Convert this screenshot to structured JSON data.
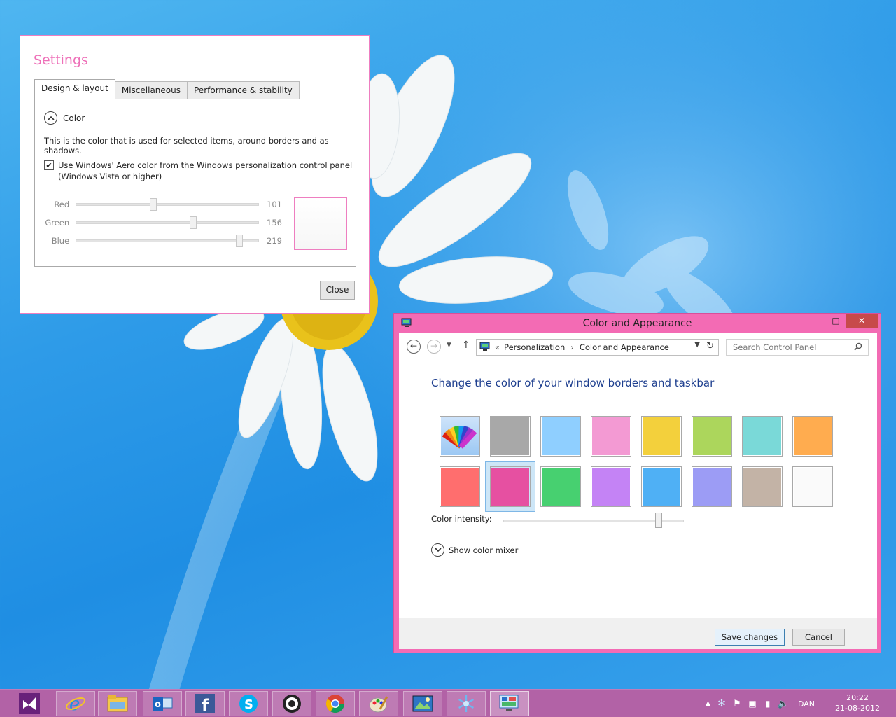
{
  "settings": {
    "title": "Settings",
    "tabs": [
      "Design & layout",
      "Miscellaneous",
      "Performance & stability"
    ],
    "section_title": "Color",
    "description": "This is the color that is used for selected items, around borders and as shadows.",
    "checkbox_label_line1": "Use Windows' Aero color from the Windows personalization control panel",
    "checkbox_label_line2": "(Windows Vista or higher)",
    "checkbox_checked": true,
    "sliders": [
      {
        "label": "Red",
        "value": "101",
        "max": 255
      },
      {
        "label": "Green",
        "value": "156",
        "max": 255
      },
      {
        "label": "Blue",
        "value": "219",
        "max": 255
      }
    ],
    "close_label": "Close",
    "accent_color": "#ee6fb8"
  },
  "color_appearance": {
    "title": "Color and Appearance",
    "min_glyph": "—",
    "max_glyph": "□",
    "close_glyph": "✕",
    "breadcrumb_prefix": "«",
    "breadcrumb_1": "Personalization",
    "breadcrumb_sep": "›",
    "breadcrumb_2": "Color and Appearance",
    "search_placeholder": "Search Control Panel",
    "heading": "Change the color of your window borders and taskbar",
    "swatches_row1": [
      "auto",
      "#a8a8a8",
      "#8fcfff",
      "#f39ad3",
      "#f3d03c",
      "#acd65c",
      "#7ad9d8",
      "#ffac4f"
    ],
    "swatches_row2": [
      "#ff6e6e",
      "#e650a1",
      "#47d070",
      "#c483f5",
      "#4fb0f5",
      "#9c9cf5",
      "#c3b3a6",
      "#fafafa"
    ],
    "selected_swatch": "#e650a1",
    "intensity_label": "Color intensity:",
    "intensity_level": 0.86,
    "mixer_label": "Show color mixer",
    "save_label": "Save changes",
    "cancel_label": "Cancel",
    "window_color": "#f36bb4"
  },
  "taskbar": {
    "color": "#b262a6",
    "apps": [
      "visual-studio-icon",
      "internet-explorer-icon",
      "file-explorer-icon",
      "outlook-icon",
      "facebook-icon",
      "skype-icon",
      "steam-icon",
      "chrome-icon",
      "paint-icon",
      "photo-viewer-icon",
      "snowflake-app-icon",
      "control-panel-icon"
    ],
    "language": "DAN",
    "time": "20:22",
    "date": "21-08-2012"
  }
}
